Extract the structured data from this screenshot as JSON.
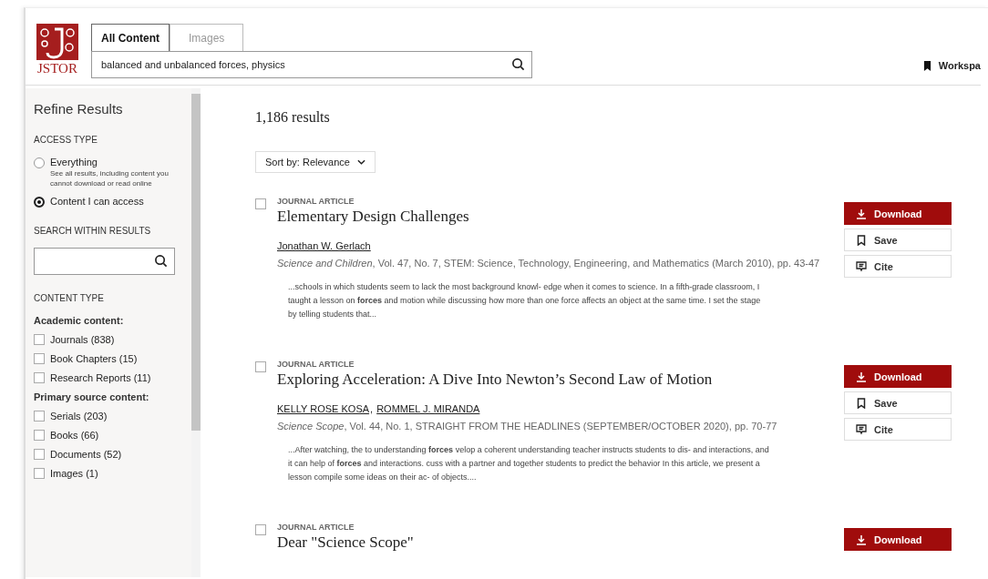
{
  "header": {
    "logo": "JSTOR",
    "tabs": [
      {
        "label": "All Content",
        "selected": true
      },
      {
        "label": "Images",
        "selected": false
      }
    ],
    "search": {
      "value": "balanced and unbalanced forces, physics"
    },
    "workspace": "Workspa"
  },
  "sidebar": {
    "title": "Refine Results",
    "access_type": {
      "heading": "ACCESS TYPE",
      "options": [
        {
          "label": "Everything",
          "note": "See all results, including content you cannot download or read online",
          "selected": false
        },
        {
          "label": "Content I can access",
          "selected": true
        }
      ]
    },
    "search_within": {
      "heading": "SEARCH WITHIN RESULTS"
    },
    "content_type": {
      "heading": "CONTENT TYPE",
      "groups": [
        {
          "label": "Academic content:",
          "items": [
            {
              "label": "Journals (838)",
              "checked": false
            },
            {
              "label": "Book Chapters (15)",
              "checked": false
            },
            {
              "label": "Research Reports (11)",
              "checked": false
            }
          ]
        },
        {
          "label": "Primary source content:",
          "items": [
            {
              "label": "Serials (203)",
              "checked": false
            },
            {
              "label": "Books (66)",
              "checked": false
            },
            {
              "label": "Documents (52)",
              "checked": false
            },
            {
              "label": "Images (1)",
              "checked": false
            }
          ]
        }
      ]
    }
  },
  "results": {
    "count": "1,186 results",
    "sort": "Sort by: Relevance",
    "items": [
      {
        "type": "JOURNAL ARTICLE",
        "title": "Elementary Design Challenges",
        "checked": false,
        "authors": [
          "Jonathan W. Gerlach"
        ],
        "meta": "*Science and Children*, Vol. 47, No. 7, STEM: Science, Technology, Engineering, and Mathematics (March 2010), pp. 43-47",
        "snippet": "...schools in which students seem to lack the most background knowl- edge when it comes to science. In a fifth-grade classroom, I taught a lesson on **forces** and motion while discussing how more than one force affects an object at the same time. I set the stage by telling students that...",
        "actions": [
          "Download",
          "Save",
          "Cite"
        ]
      },
      {
        "type": "JOURNAL ARTICLE",
        "title": "Exploring Acceleration: A Dive Into Newton’s Second Law of Motion",
        "checked": false,
        "authors": [
          "KELLY ROSE KOSA",
          "ROMMEL J. MIRANDA"
        ],
        "author_separator": ",",
        "meta": "*Science Scope*, Vol. 44, No. 1, STRAIGHT FROM THE HEADLINES (SEPTEMBER/OCTOBER 2020), pp. 70-77",
        "snippet": "...After watching, the to understanding **forces** velop a coherent understanding teacher instructs students to dis- and interactions, and it can help of **forces** and interactions. cuss with a partner and together students to predict the behavior In this article, we present a lesson compile some ideas on their ac- of objects....",
        "actions": [
          "Download",
          "Save",
          "Cite"
        ]
      },
      {
        "type": "JOURNAL ARTICLE",
        "title": "Dear \"Science Scope\"",
        "checked": false,
        "actions": [
          "Download"
        ]
      }
    ]
  }
}
